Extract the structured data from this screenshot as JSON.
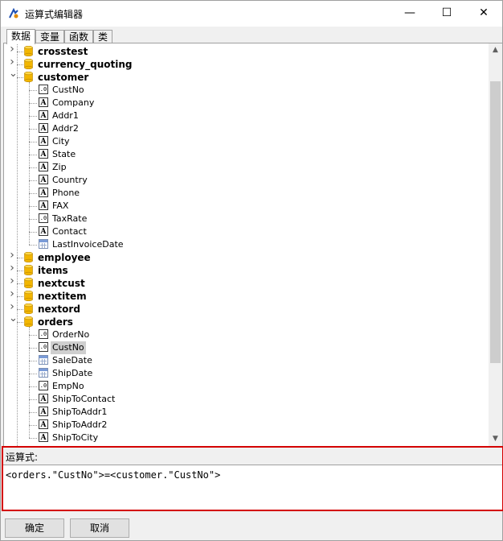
{
  "window": {
    "title": "运算式编辑器",
    "minimize_glyph": "—",
    "maximize_glyph": "☐",
    "close_glyph": "✕"
  },
  "tabs": [
    {
      "label": "数据",
      "active": true
    },
    {
      "label": "变量",
      "active": false
    },
    {
      "label": "函数",
      "active": false
    },
    {
      "label": "类",
      "active": false
    }
  ],
  "tree": {
    "tables": [
      {
        "name": "crosstest",
        "expanded": false
      },
      {
        "name": "currency_quoting",
        "expanded": false
      },
      {
        "name": "customer",
        "expanded": true,
        "fields": [
          {
            "name": "CustNo",
            "type": "number"
          },
          {
            "name": "Company",
            "type": "text"
          },
          {
            "name": "Addr1",
            "type": "text"
          },
          {
            "name": "Addr2",
            "type": "text"
          },
          {
            "name": "City",
            "type": "text"
          },
          {
            "name": "State",
            "type": "text"
          },
          {
            "name": "Zip",
            "type": "text"
          },
          {
            "name": "Country",
            "type": "text"
          },
          {
            "name": "Phone",
            "type": "text"
          },
          {
            "name": "FAX",
            "type": "text"
          },
          {
            "name": "TaxRate",
            "type": "number"
          },
          {
            "name": "Contact",
            "type": "text"
          },
          {
            "name": "LastInvoiceDate",
            "type": "date"
          }
        ]
      },
      {
        "name": "employee",
        "expanded": false
      },
      {
        "name": "items",
        "expanded": false
      },
      {
        "name": "nextcust",
        "expanded": false
      },
      {
        "name": "nextitem",
        "expanded": false
      },
      {
        "name": "nextord",
        "expanded": false
      },
      {
        "name": "orders",
        "expanded": true,
        "fields": [
          {
            "name": "OrderNo",
            "type": "number"
          },
          {
            "name": "CustNo",
            "type": "number",
            "selected": true
          },
          {
            "name": "SaleDate",
            "type": "date"
          },
          {
            "name": "ShipDate",
            "type": "date"
          },
          {
            "name": "EmpNo",
            "type": "number"
          },
          {
            "name": "ShipToContact",
            "type": "text"
          },
          {
            "name": "ShipToAddr1",
            "type": "text"
          },
          {
            "name": "ShipToAddr2",
            "type": "text"
          },
          {
            "name": "ShipToCity",
            "type": "text"
          }
        ]
      }
    ]
  },
  "expression": {
    "label": "运算式:",
    "value": "<orders.\"CustNo\">=<customer.\"CustNo\">"
  },
  "buttons": {
    "ok": "确定",
    "cancel": "取消"
  },
  "colors": {
    "highlight_border": "#d40000",
    "db_icon": "#f2b600",
    "selected_bg": "#cfcfcf"
  },
  "icons": {
    "text_field": "A",
    "number_field": ".0"
  }
}
